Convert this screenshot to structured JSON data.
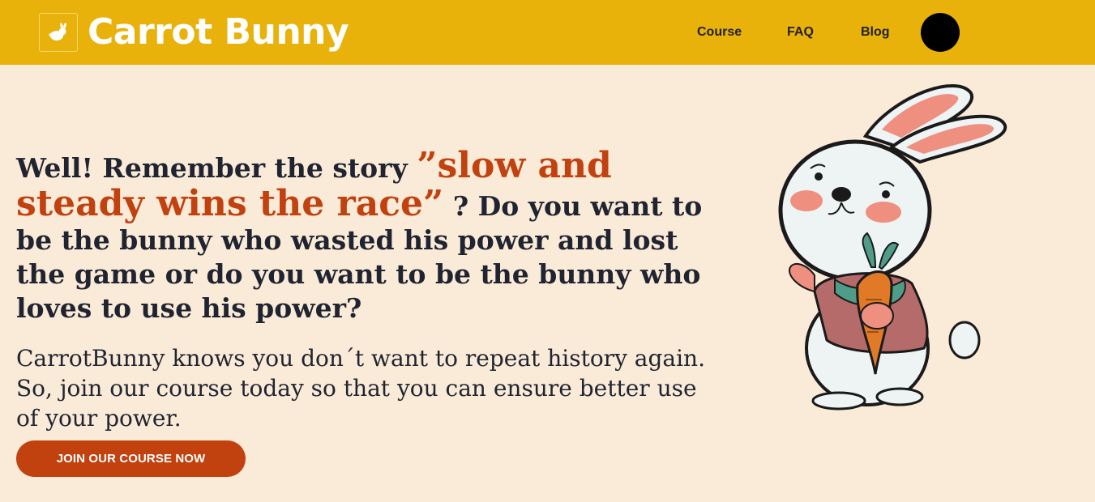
{
  "header": {
    "logo_icon": "bunny-logo-icon",
    "brand": "Carrot Bunny",
    "nav": {
      "course": "Course",
      "faq": "FAQ",
      "blog": "Blog"
    },
    "avatar_icon": "user-avatar"
  },
  "hero": {
    "heading_prefix": "Well! Remember the story ",
    "heading_highlight": "”slow and steady wins the race”",
    "heading_suffix": " ? Do you want to be the bunny who wasted his power and lost the game or do you want to be the bunny who loves to use his power?",
    "body": "CarrotBunny knows you don´t want to repeat history again. So, join our course today so that you can ensure better use of your power.",
    "cta_label": "JOIN OUR COURSE NOW",
    "illustration": "bunny-holding-carrot-illustration"
  },
  "colors": {
    "navbar": "#e8b20a",
    "background": "#faead8",
    "accent": "#c1420f",
    "text": "#1f2430"
  }
}
